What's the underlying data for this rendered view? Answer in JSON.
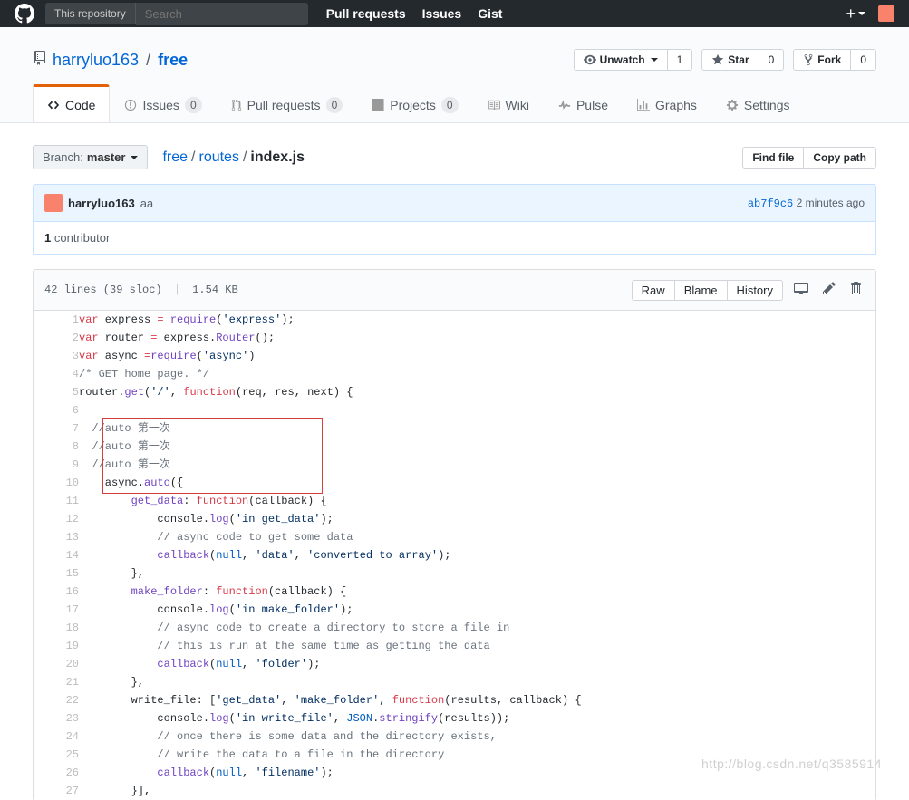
{
  "header": {
    "search_scope": "This repository",
    "search_placeholder": "Search",
    "nav": {
      "pulls": "Pull requests",
      "issues": "Issues",
      "gist": "Gist"
    }
  },
  "repo": {
    "owner": "harryluo163",
    "name": "free"
  },
  "actions": {
    "unwatch": "Unwatch",
    "unwatch_count": "1",
    "star": "Star",
    "star_count": "0",
    "fork": "Fork",
    "fork_count": "0"
  },
  "tabs": {
    "code": "Code",
    "issues": "Issues",
    "issues_count": "0",
    "pulls": "Pull requests",
    "pulls_count": "0",
    "projects": "Projects",
    "projects_count": "0",
    "wiki": "Wiki",
    "pulse": "Pulse",
    "graphs": "Graphs",
    "settings": "Settings"
  },
  "branch": {
    "label": "Branch:",
    "value": "master"
  },
  "breadcrumb": {
    "root": "free",
    "dir": "routes",
    "file": "index.js"
  },
  "filebtns": {
    "find": "Find file",
    "copy": "Copy path"
  },
  "commit": {
    "author": "harryluo163",
    "message": "aa",
    "sha": "ab7f9c6",
    "time": "2 minutes ago"
  },
  "contributors": {
    "count": "1",
    "label": "contributor"
  },
  "filemeta": {
    "info": "42 lines (39 sloc)",
    "size": "1.54 KB",
    "raw": "Raw",
    "blame": "Blame",
    "history": "History"
  },
  "code": [
    {
      "n": 1,
      "h": "<span class='pl-k'>var</span> express <span class='pl-k'>=</span> <span class='pl-en'>require</span>(<span class='pl-s'>'express'</span>);"
    },
    {
      "n": 2,
      "h": "<span class='pl-k'>var</span> router <span class='pl-k'>=</span> express.<span class='pl-en'>Router</span>();"
    },
    {
      "n": 3,
      "h": "<span class='pl-k'>var</span> async <span class='pl-k'>=</span><span class='pl-en'>require</span>(<span class='pl-s'>'async'</span>)"
    },
    {
      "n": 4,
      "h": "<span class='pl-c'>/* GET home page. */</span>"
    },
    {
      "n": 5,
      "h": "router.<span class='pl-en'>get</span>(<span class='pl-s'>'/'</span>, <span class='pl-k'>function</span>(<span class='pl-smi'>req</span>, <span class='pl-smi'>res</span>, <span class='pl-smi'>next</span>) {"
    },
    {
      "n": 6,
      "h": ""
    },
    {
      "n": 7,
      "h": "  <span class='pl-c'>//auto 第一次</span>"
    },
    {
      "n": 8,
      "h": "  <span class='pl-c'>//auto 第一次</span>"
    },
    {
      "n": 9,
      "h": "  <span class='pl-c'>//auto 第一次</span>"
    },
    {
      "n": 10,
      "h": "    async.<span class='pl-en'>auto</span>({"
    },
    {
      "n": 11,
      "h": "        <span class='pl-en'>get_data</span>: <span class='pl-k'>function</span>(<span class='pl-smi'>callback</span>) {"
    },
    {
      "n": 12,
      "h": "            console.<span class='pl-en'>log</span>(<span class='pl-s'>'in get_data'</span>);"
    },
    {
      "n": 13,
      "h": "            <span class='pl-c'>// async code to get some data</span>"
    },
    {
      "n": 14,
      "h": "            <span class='pl-en'>callback</span>(<span class='pl-c1'>null</span>, <span class='pl-s'>'data'</span>, <span class='pl-s'>'converted to array'</span>);"
    },
    {
      "n": 15,
      "h": "        },"
    },
    {
      "n": 16,
      "h": "        <span class='pl-en'>make_folder</span>: <span class='pl-k'>function</span>(<span class='pl-smi'>callback</span>) {"
    },
    {
      "n": 17,
      "h": "            console.<span class='pl-en'>log</span>(<span class='pl-s'>'in make_folder'</span>);"
    },
    {
      "n": 18,
      "h": "            <span class='pl-c'>// async code to create a directory to store a file in</span>"
    },
    {
      "n": 19,
      "h": "            <span class='pl-c'>// this is run at the same time as getting the data</span>"
    },
    {
      "n": 20,
      "h": "            <span class='pl-en'>callback</span>(<span class='pl-c1'>null</span>, <span class='pl-s'>'folder'</span>);"
    },
    {
      "n": 21,
      "h": "        },"
    },
    {
      "n": 22,
      "h": "        write_file: [<span class='pl-s'>'get_data'</span>, <span class='pl-s'>'make_folder'</span>, <span class='pl-k'>function</span>(<span class='pl-smi'>results</span>, <span class='pl-smi'>callback</span>) {"
    },
    {
      "n": 23,
      "h": "            console.<span class='pl-en'>log</span>(<span class='pl-s'>'in write_file'</span>, <span class='pl-c1'>JSON</span>.<span class='pl-en'>stringify</span>(results));"
    },
    {
      "n": 24,
      "h": "            <span class='pl-c'>// once there is some data and the directory exists,</span>"
    },
    {
      "n": 25,
      "h": "            <span class='pl-c'>// write the data to a file in the directory</span>"
    },
    {
      "n": 26,
      "h": "            <span class='pl-en'>callback</span>(<span class='pl-c1'>null</span>, <span class='pl-s'>'filename'</span>);"
    },
    {
      "n": 27,
      "h": "        }],"
    }
  ],
  "watermark": "http://blog.csdn.net/q3585914"
}
